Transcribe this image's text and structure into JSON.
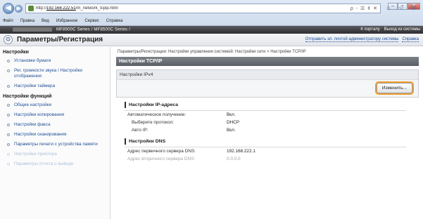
{
  "browser": {
    "url_prefix": "http://",
    "url_host": "192.168.222.51",
    "url_path": "/m_network_tcpip.html",
    "addr_controls": "ρ - ☰ ¢ ✕",
    "menu": [
      "Файл",
      "Правка",
      "Вид",
      "Избранное",
      "Сервис",
      "Справка"
    ]
  },
  "device": {
    "model_text": "MF8500C Series / MF8500C Series /",
    "links": [
      "К порталу",
      "Выход из системы"
    ]
  },
  "titlebar": {
    "title": "Параметры/Регистрация",
    "links": [
      "Отправить эл. почтой администратору системы",
      "Справка"
    ]
  },
  "sidebar": {
    "heading1": "Настройки",
    "items1": [
      "Установки бумаги",
      "Рег. громкости звука / Настройки отображения",
      "Настройки таймера"
    ],
    "heading2": "Настройки функций",
    "items2": [
      "Общие настройки",
      "Настройки копирования",
      "Настройки факса",
      "Настройки сканирования",
      "Параметры печати с устройства памяти",
      "Настройки принтера",
      "Параметры отчета о выводе"
    ]
  },
  "main": {
    "breadcrumb": "Параметры/Регистрация: Настройки управления системой: Настройки сети > Настройки TCP/IP",
    "panel_title": "Настройки TCP/IP",
    "subpanel_title": "Настройки IPv4",
    "edit_button": "Изменить...",
    "ip_section": {
      "title": "Настройки IP-адреса",
      "rows": [
        {
          "k": "Автоматическое получение:",
          "v": "Вкл."
        },
        {
          "k": "Выберите протокол:",
          "v": "DHCP"
        },
        {
          "k": "Авто IP:",
          "v": "Вкл."
        }
      ]
    },
    "dns_section": {
      "title": "Настройки DNS",
      "rows": [
        {
          "k": "Адрес первичного сервера DNS:",
          "v": "192.168.222.1"
        },
        {
          "k": "Адрес вторичного сервера DNS:",
          "v": "0.0.0.0"
        }
      ]
    }
  }
}
